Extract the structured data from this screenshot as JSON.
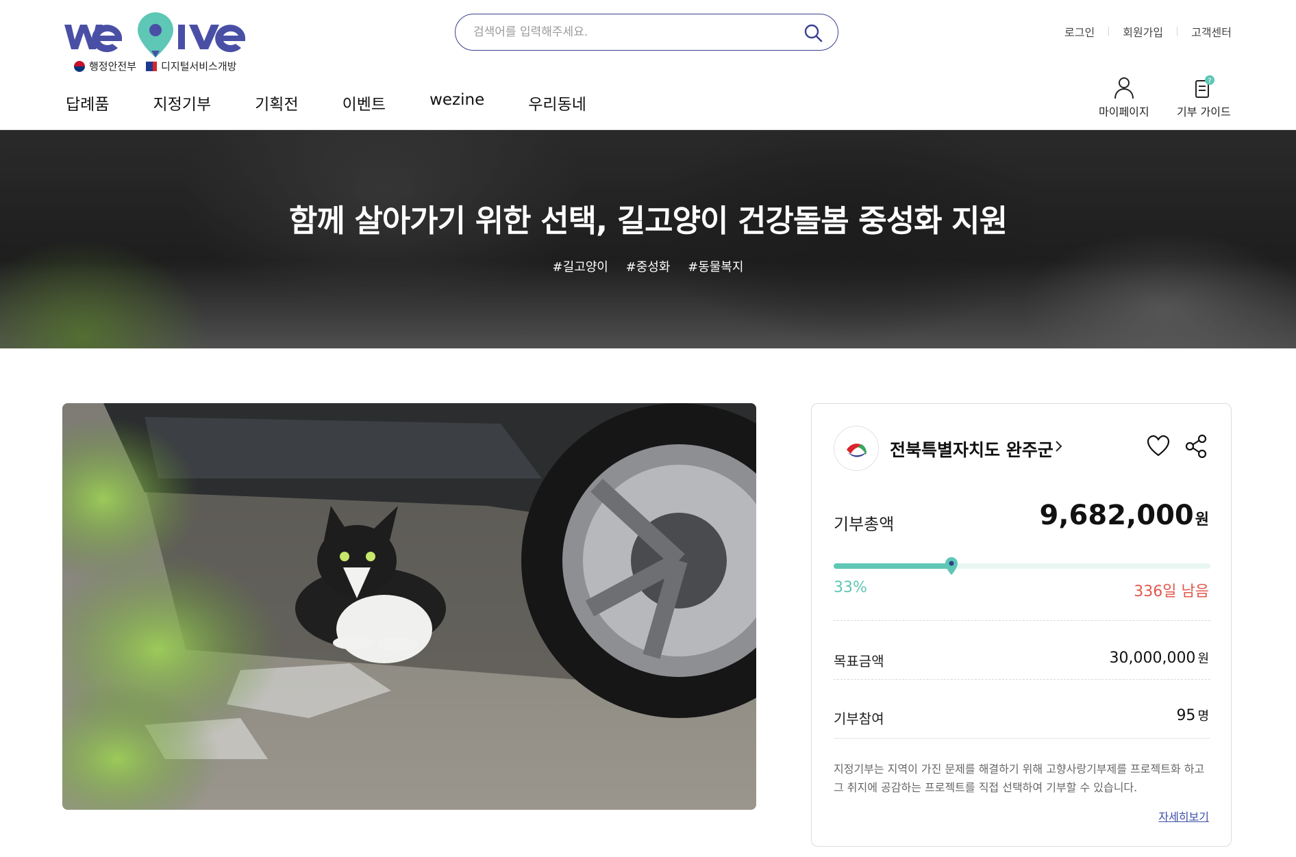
{
  "brand": {
    "logo_text": "we give",
    "sub_gov": "행정안전부",
    "sub_service": "디지털서비스개방"
  },
  "search": {
    "placeholder": "검색어를 입력해주세요."
  },
  "util_links": [
    "로그인",
    "회원가입",
    "고객센터"
  ],
  "nav": [
    "답례품",
    "지정기부",
    "기획전",
    "이벤트",
    "wezine",
    "우리동네"
  ],
  "quick": {
    "mypage": "마이페이지",
    "guide": "기부 가이드"
  },
  "hero": {
    "title": "함께 살아가기 위한 선택, 길고양이 건강돌봄 중성화 지원",
    "tags": [
      "#길고양이",
      "#중성화",
      "#동물복지"
    ]
  },
  "card": {
    "org_name": "전북특별자치도 완주군",
    "total_label": "기부총액",
    "total_value": "9,682,000",
    "total_unit": "원",
    "progress": 0.33,
    "percent_text": "33%",
    "remain_text": "336일 남음",
    "goal_label": "목표금액",
    "goal_value": "30,000,000",
    "goal_unit": "원",
    "participants_label": "기부참여",
    "participants_value": "95",
    "participants_unit": "명",
    "note": "지정기부는 지역이 가진 문제를 해결하기 위해 고향사랑기부제를 프로젝트화 하고 그 취지에 공감하는 프로젝트를 직접 선택하여 기부할 수 있습니다.",
    "more_link": "자세히보기"
  },
  "colors": {
    "brand": "#4a4fa6",
    "accent": "#5ec7b5",
    "remain": "#e2574c"
  }
}
